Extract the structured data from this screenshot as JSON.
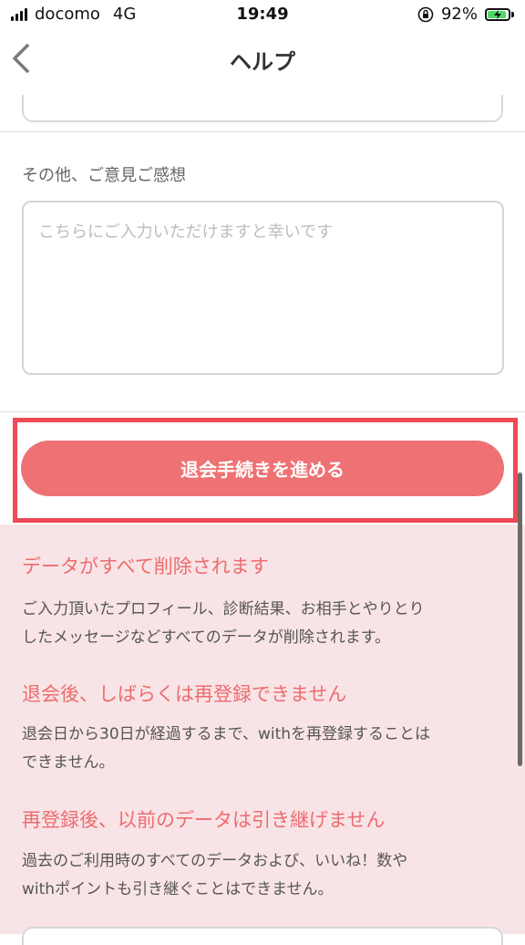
{
  "status_bar": {
    "carrier": "docomo",
    "network": "4G",
    "time": "19:49",
    "battery_percent": "92%",
    "battery_level": 0.92,
    "battery_color": "#4cd964",
    "icons": [
      "signal-icon",
      "orientation-lock-icon",
      "battery-charging-icon"
    ]
  },
  "nav": {
    "title": "ヘルプ",
    "back_icon": "chevron-left-icon"
  },
  "feedback": {
    "label": "その他、ご意見ご感想",
    "placeholder": "こちらにご入力いただけますと幸いです",
    "value": ""
  },
  "withdraw": {
    "button_label": "退会手続きを進める",
    "button_color": "#ee7274",
    "highlight_color": "#ef4a56"
  },
  "notice": {
    "background": "#f8e4e6",
    "heading_color": "#ee6b6f",
    "items": [
      {
        "heading": "データがすべて削除されます",
        "body_lines": [
          "ご入力頂いたプロフィール、診断結果、お相手とやりとり",
          "したメッセージなどすべてのデータが削除されます。"
        ]
      },
      {
        "heading": "退会後、しばらくは再登録できません",
        "body_lines": [
          "退会日から30日が経過するまで、withを再登録することは",
          "できません。"
        ]
      },
      {
        "heading": "再登録後、以前のデータは引き継げません",
        "body_lines": [
          "過去のご利用時のすべてのデータおよび、いいね！数や",
          "withポイントも引き継ぐことはできません。"
        ]
      }
    ]
  }
}
